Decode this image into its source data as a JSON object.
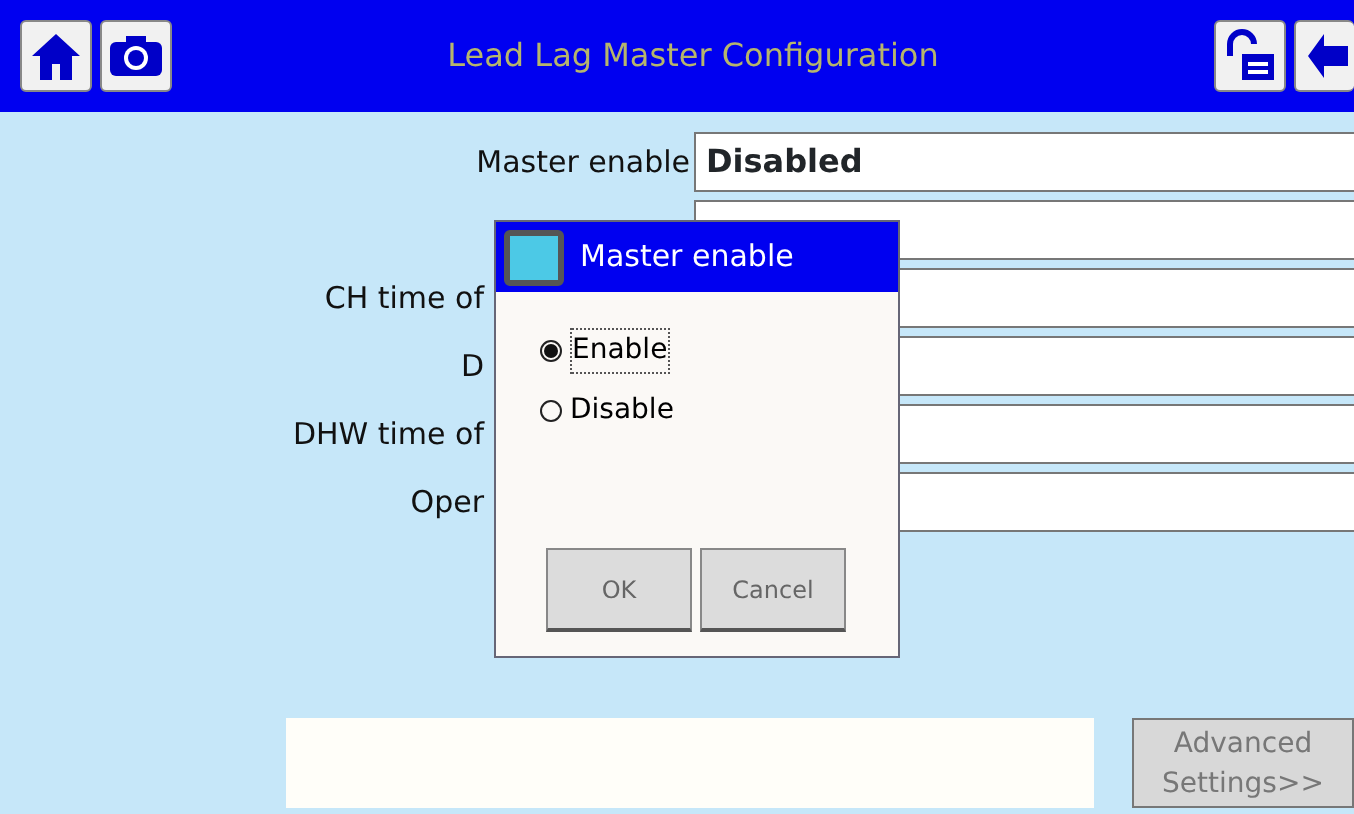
{
  "window": {
    "title": "Lead Lag Master Configuration"
  },
  "fields": [
    {
      "kind": "input",
      "label": "Master enable",
      "value": "Disabled"
    },
    {
      "kind": "input"
    },
    {
      "kind": "input",
      "label": "CH time of",
      "covered": true
    },
    {
      "kind": "input",
      "label": "D",
      "covered": true
    },
    {
      "kind": "input",
      "label": "DHW time of",
      "covered": true
    },
    {
      "kind": "input",
      "label": "Oper",
      "covered": true
    }
  ],
  "dialog": {
    "title": "Master enable",
    "options": [
      {
        "label": "Enable",
        "selected": true
      },
      {
        "label": "Disable",
        "selected": false
      }
    ],
    "buttons": [
      "OK",
      "Cancel"
    ]
  },
  "advanced_button": "Advanced Settings>>"
}
